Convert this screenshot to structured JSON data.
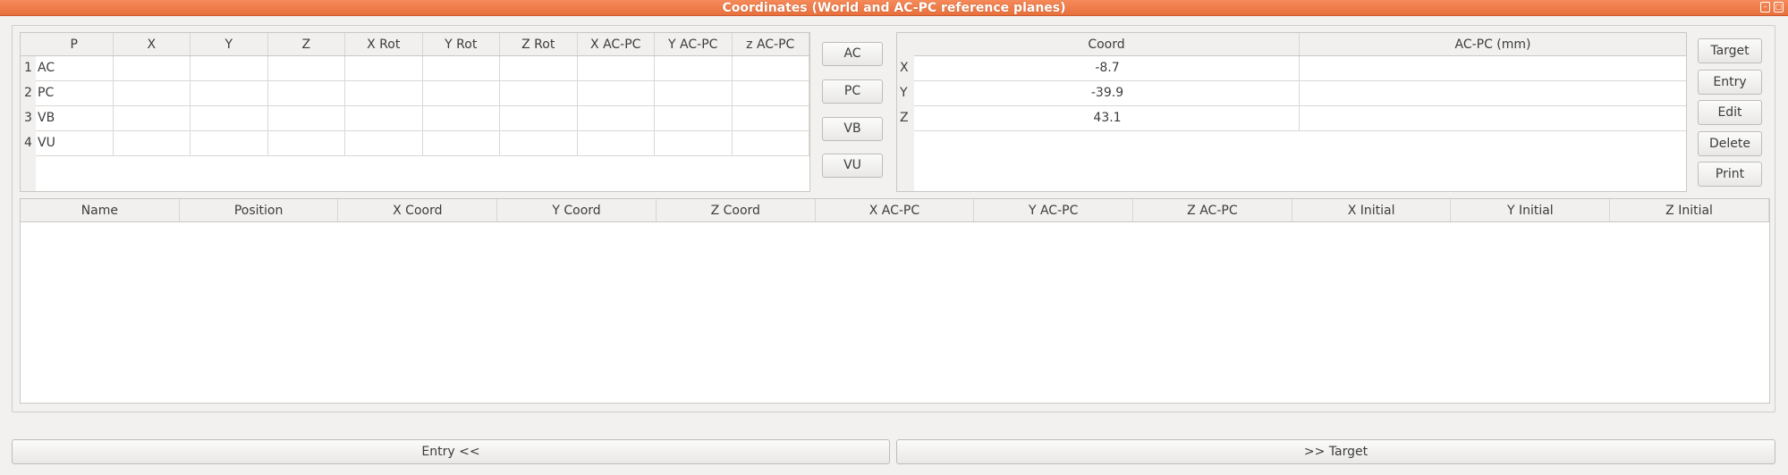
{
  "window": {
    "title": "Coordinates (World and AC-PC reference planes)"
  },
  "points_table": {
    "columns": [
      "P",
      "X",
      "Y",
      "Z",
      "X Rot",
      "Y Rot",
      "Z Rot",
      "X AC-PC",
      "Y AC-PC",
      "z AC-PC"
    ],
    "rows": [
      {
        "num": "1",
        "p": "AC"
      },
      {
        "num": "2",
        "p": "PC"
      },
      {
        "num": "3",
        "p": "VB"
      },
      {
        "num": "4",
        "p": "VU"
      }
    ]
  },
  "point_buttons": [
    "AC",
    "PC",
    "VB",
    "VU"
  ],
  "coord_table": {
    "columns": [
      "Coord",
      "AC-PC (mm)"
    ],
    "rows": [
      {
        "axis": "X",
        "coord": "-8.7",
        "acpc": ""
      },
      {
        "axis": "Y",
        "coord": "-39.9",
        "acpc": ""
      },
      {
        "axis": "Z",
        "coord": "43.1",
        "acpc": ""
      }
    ]
  },
  "side_buttons": [
    "Target",
    "Entry",
    "Edit",
    "Delete",
    "Print"
  ],
  "trajectory_table": {
    "columns": [
      "Name",
      "Position",
      "X Coord",
      "Y Coord",
      "Z Coord",
      "X AC-PC",
      "Y AC-PC",
      "Z AC-PC",
      "X Initial",
      "Y Initial",
      "Z Initial"
    ]
  },
  "bottom_buttons": {
    "entry": "Entry    <<",
    "target": ">>    Target"
  },
  "colors": {
    "titlebar": "#ed7440"
  }
}
